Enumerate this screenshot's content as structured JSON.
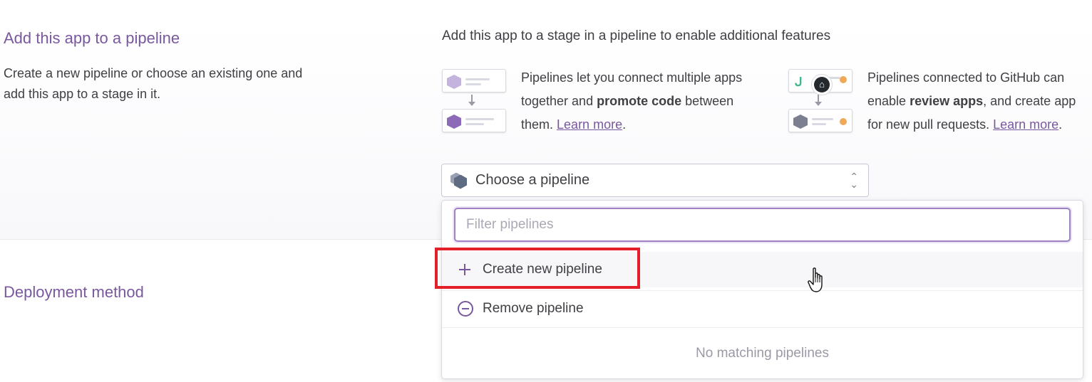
{
  "pipeline_section": {
    "title": "Add this app to a pipeline",
    "description": "Create a new pipeline or choose an existing one and add this app to a stage in it.",
    "heading": "Add this app to a stage in a pipeline to enable additional features",
    "feature_1": {
      "text_a": "Pipelines let you connect multiple apps together and ",
      "bold": "promote code",
      "text_b": " between them. ",
      "link": "Learn more",
      "text_c": "."
    },
    "feature_2": {
      "line1": "Pipelines connected to GitHub can",
      "text_a": "enable ",
      "bold": "review apps",
      "text_b": ", and create app",
      "text_c": "for new pull requests. ",
      "link": "Learn more",
      "text_d": "."
    }
  },
  "pipeline_select": {
    "label": "Choose a pipeline",
    "filter_placeholder": "Filter pipelines",
    "create_label": "Create new pipeline",
    "remove_label": "Remove pipeline",
    "empty_message": "No matching pipelines"
  },
  "deployment_section": {
    "title": "Deployment method"
  },
  "colors": {
    "accent": "#79589f",
    "highlight": "#e3202a"
  },
  "icons": [
    "pipeline-hex-icon",
    "plus-icon",
    "minus-circle-icon",
    "github-icon",
    "chevron-updown-icon",
    "hand-pointer-cursor"
  ]
}
